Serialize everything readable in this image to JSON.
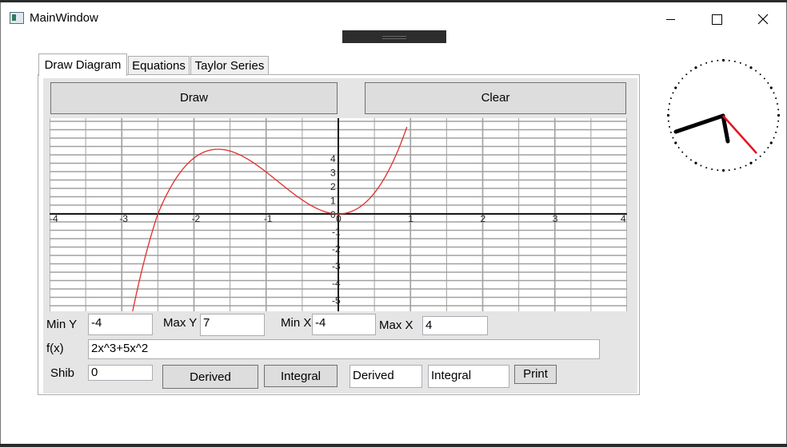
{
  "window": {
    "title": "MainWindow",
    "icon": "app-window-icon"
  },
  "tabs": [
    {
      "label": "Draw Diagram"
    },
    {
      "label": "Equations"
    },
    {
      "label": "Taylor Series"
    }
  ],
  "toolbar": {
    "draw_label": "Draw",
    "clear_label": "Clear"
  },
  "form": {
    "min_y_label": "Min Y",
    "min_y_value": "-4",
    "max_y_label": "Max Y",
    "max_y_value": "7",
    "min_x_label": "Min X",
    "min_x_value": "-4",
    "max_x_label": "Max X",
    "max_x_value": "4",
    "fx_label": "f(x)",
    "fx_value": "2x^3+5x^2",
    "shib_label": "Shib",
    "shib_value": "0",
    "derived_button": "Derived",
    "integral_button": "Integral",
    "derived_output": "Derived",
    "integral_output": "Integral",
    "print_button": "Print"
  },
  "chart_data": {
    "type": "line",
    "function": "2x^3+5x^2",
    "xlim": [
      -4,
      4
    ],
    "ylim": [
      -5,
      5
    ],
    "x_ticks": [
      "-4",
      "-3",
      "-2",
      "-1",
      "0",
      "1",
      "2",
      "3",
      "4"
    ],
    "y_ticks_positive": [
      "4",
      "3",
      "2",
      "1",
      "0"
    ],
    "y_ticks_negative": [
      "-1",
      "-2",
      "-3",
      "-4",
      "-5"
    ],
    "grid": true,
    "line_color": "#e32b2b"
  },
  "clock": {
    "hour_hand_color": "#000000",
    "second_hand_color": "#e81123"
  }
}
